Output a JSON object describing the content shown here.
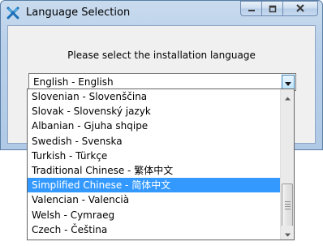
{
  "window": {
    "title": "Language Selection",
    "minimize_icon": "minimize-icon",
    "maximize_icon": "maximize-icon",
    "close_icon": "close-icon",
    "app_icon": "installer-x-icon"
  },
  "dialog": {
    "prompt": "Please select the installation language",
    "selected_language": "English - English"
  },
  "dropdown": {
    "items": [
      "Slovenian - Slovenščina",
      "Slovak - Slovenský jazyk",
      "Albanian - Gjuha shqipe",
      "Swedish - Svenska",
      "Turkish - Türkçe",
      "Traditional Chinese - 繁体中文",
      "Simplified Chinese - 简体中文",
      "Valencian - Valencià",
      "Welsh - Cymraeg",
      "Czech - Čeština"
    ],
    "highlighted_index": 6
  },
  "colors": {
    "highlight": "#3399ff",
    "title_bar": "#b9d0ea"
  }
}
